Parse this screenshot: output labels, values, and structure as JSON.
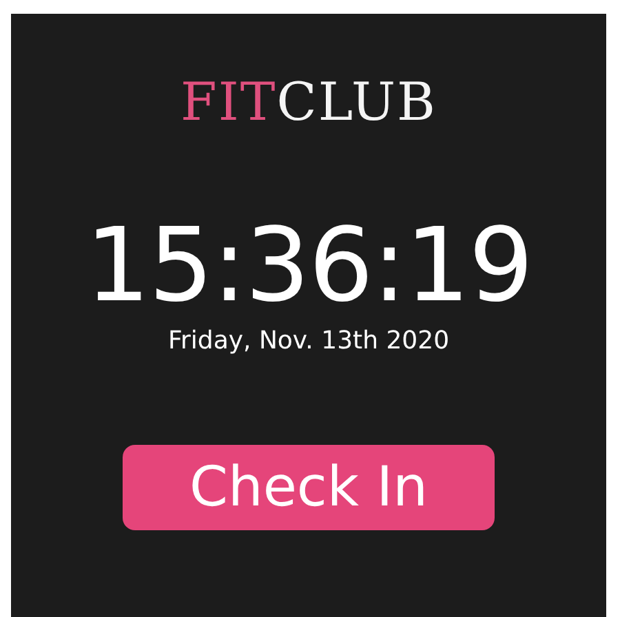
{
  "logo": [
    {
      "text": "FIT",
      "color": "#e0507e"
    },
    {
      "text": "CLUB",
      "color": "#f4f4f4"
    }
  ],
  "clock": {
    "time": "15:36:19",
    "date": "Friday, Nov. 13th 2020"
  },
  "check_in_button": {
    "label": "Check In"
  }
}
